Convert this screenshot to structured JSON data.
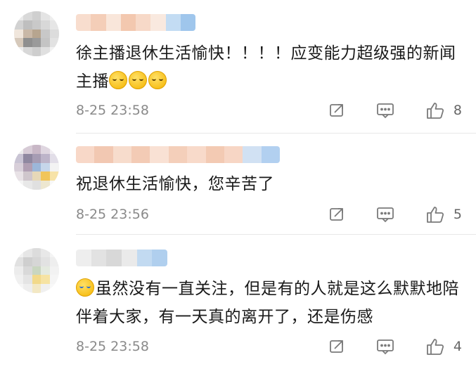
{
  "comments": [
    {
      "text": "徐主播退休生活愉快！！！！应变能力超级强的新闻主播",
      "emoji_suffix": [
        "awkward-face-emoji",
        "awkward-face-emoji",
        "awkward-face-emoji"
      ],
      "time": "8-25 23:58",
      "likes": "8"
    },
    {
      "text": "祝退休生活愉快，您辛苦了",
      "time": "8-25 23:56",
      "likes": "5"
    },
    {
      "emoji_prefix": "crying-face-emoji",
      "text": "虽然没有一直关注，但是有的人就是这么默默地陪伴着大家，有一天真的离开了，还是伤感",
      "time": "8-25 23:58",
      "likes": "4"
    }
  ],
  "colors": {
    "time_gray": "#8a8a8a",
    "icon_gray": "#7a7a7a",
    "divider": "#e8e8e8"
  }
}
